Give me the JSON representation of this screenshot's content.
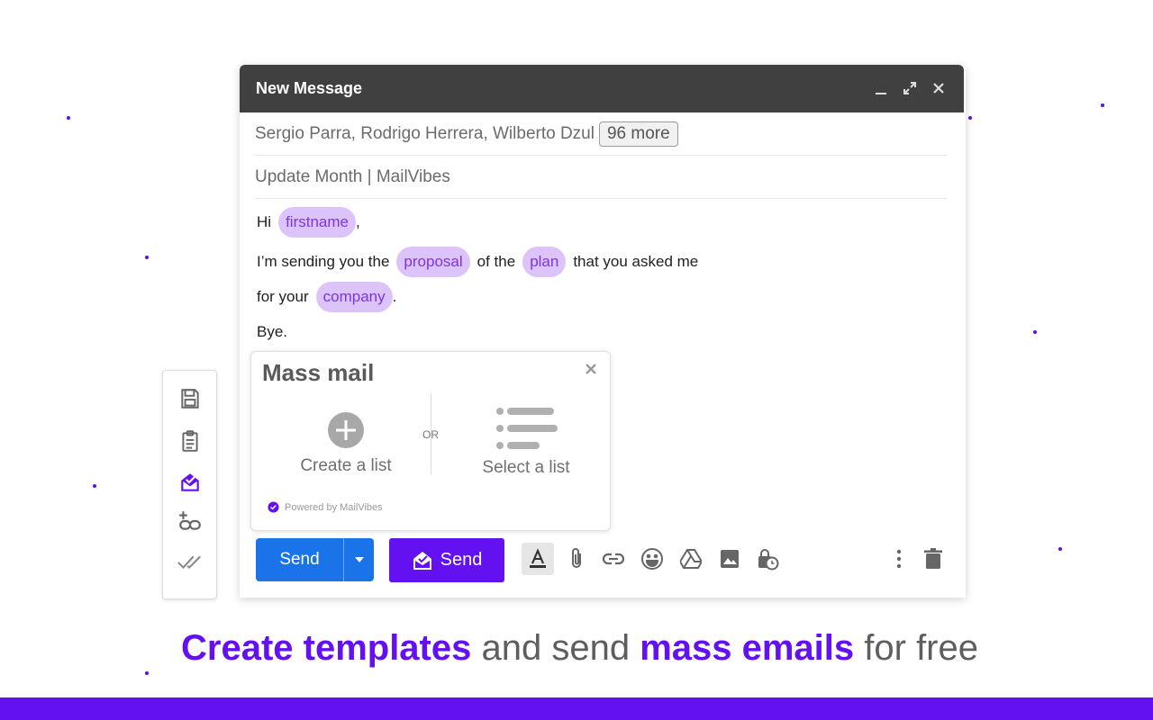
{
  "colors": {
    "accent": "#6311f0",
    "gmail_blue": "#1a73e8",
    "chip_bg": "#dcc4fb",
    "chip_text": "#7e34e2",
    "header_bg": "#404040"
  },
  "compose": {
    "title": "New Message",
    "recipients": "Sergio Parra, Rodrigo Herrera, Wilberto Dzul",
    "recipients_more": "96 more",
    "subject": "Update Month | MailVibes",
    "body": {
      "l1_a": "Hi",
      "l1_chip": "firstname",
      "l1_b": ",",
      "l2_a": "I’m sending you the",
      "l2_chip1": "proposal",
      "l2_b": "of the",
      "l2_chip2": "plan",
      "l2_c": "that you asked me",
      "l3_a": "for your",
      "l3_chip": "company",
      "l3_b": ".",
      "l4": "Bye."
    }
  },
  "mass_mail": {
    "title": "Mass mail",
    "create": "Create a list",
    "or": "OR",
    "select": "Select a list",
    "powered": "Powered by MailVibes"
  },
  "toolbar": {
    "send_label": "Send",
    "mv_send_label": "Send"
  },
  "side_toolbar": [
    "save-icon",
    "clipboard-icon",
    "mailvibes-send-icon",
    "add-link-icon",
    "double-check-icon"
  ],
  "headline": {
    "p1": "Create templates",
    "p2": " and send ",
    "p3": "mass emails",
    "p4": " for free"
  }
}
